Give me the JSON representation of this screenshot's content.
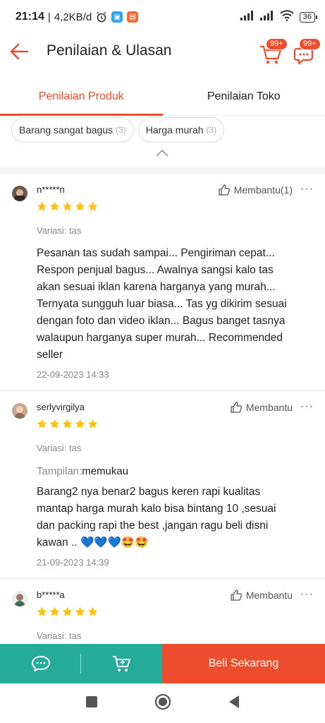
{
  "status_bar": {
    "time": "21:14",
    "speed": "4,2KB/d",
    "battery": "36"
  },
  "header": {
    "title": "Penilaian & Ulasan",
    "cart_badge": "99+",
    "chat_badge": "99+"
  },
  "tabs": [
    {
      "label": "Penilaian Produk",
      "active": true
    },
    {
      "label": "Penilaian Toko",
      "active": false
    }
  ],
  "filters": [
    {
      "label": "Barang sangat bagus",
      "count": "(3)"
    },
    {
      "label": "Harga murah",
      "count": "(3)"
    }
  ],
  "reviews": [
    {
      "username": "n*****n",
      "helpful": "Membantu(1)",
      "rating": 5,
      "variation": "Variasi: tas",
      "content_lines": [
        "Pesanan tas sudah sampai... Pengiriman cepat...",
        "Respon penjual bagus... Awalnya sangsi kalo tas",
        "akan sesuai iklan karena harganya yang murah...",
        "Ternyata sungguh luar biasa... Tas yg dikirim sesuai",
        "dengan foto dan video iklan... Bagus banget tasnya",
        "walaupun harganya super murah... Recommended",
        "seller"
      ],
      "date": "22-09-2023 14:33"
    },
    {
      "username": "serlyvirgilya",
      "helpful": "Membantu",
      "rating": 5,
      "variation": "Variasi: tas",
      "tampilan_label": "Tampilan:",
      "tampilan_value": "memukau",
      "content_lines": [
        "Barang2 nya benar2 bagus keren rapi kualitas",
        "mantap harga murah kalo bisa  bintang 10 ,sesuai",
        "dan packing rapi the best ,jangan ragu beli disni",
        "kawan .. 💙💙💙🤩🤩"
      ],
      "date": "21-09-2023 14:39"
    },
    {
      "username": "b*****a",
      "helpful": "Membantu",
      "rating": 5,
      "variation": "Variasi: tas"
    }
  ],
  "bottom_bar": {
    "buy_label": "Beli Sekarang"
  },
  "colors": {
    "accent": "#ee4d2d",
    "teal": "#26aa99",
    "star": "#ffc107"
  },
  "more_glyph": "···"
}
